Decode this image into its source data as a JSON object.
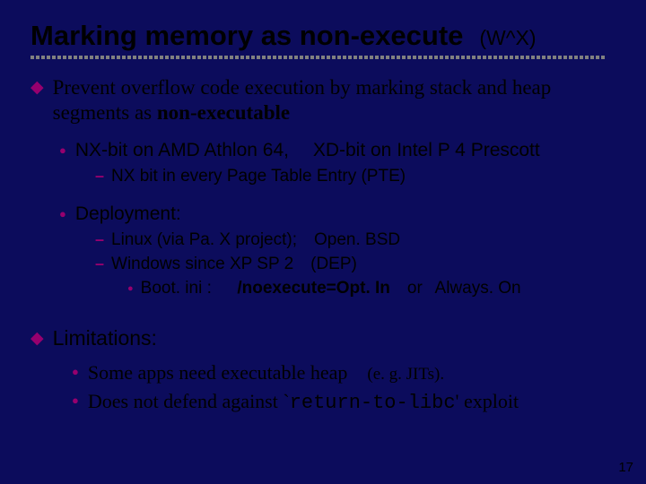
{
  "title": "Marking memory as non-execute",
  "title_right": "(W^X)",
  "bullets": {
    "b1_pre": "Prevent overflow code execution by marking stack and heap segments as ",
    "b1_bold": "non-executable",
    "b2": "NX-bit on AMD Athlon 64,  XD-bit on Intel P 4  Prescott",
    "b2a": "NX bit in every Page Table Entry (PTE)",
    "b3": "Deployment:",
    "b3a": "Linux (via Pa. X project); Open. BSD",
    "b3b": "Windows since XP SP 2 (DEP)",
    "b3c_pre": "Boot. ini :  ",
    "b3c_bold": "/noexecute=Opt. In",
    "b3c_post": " or  Always. On",
    "b4": "Limitations:",
    "b4a_pre": "Some apps need executable heap ",
    "b4a_small": "(e. g.  JITs).",
    "b4b_pre": "Does not defend against  `",
    "b4b_mono": "return-to-libc",
    "b4b_post": "' exploit"
  },
  "pagenum": "17"
}
